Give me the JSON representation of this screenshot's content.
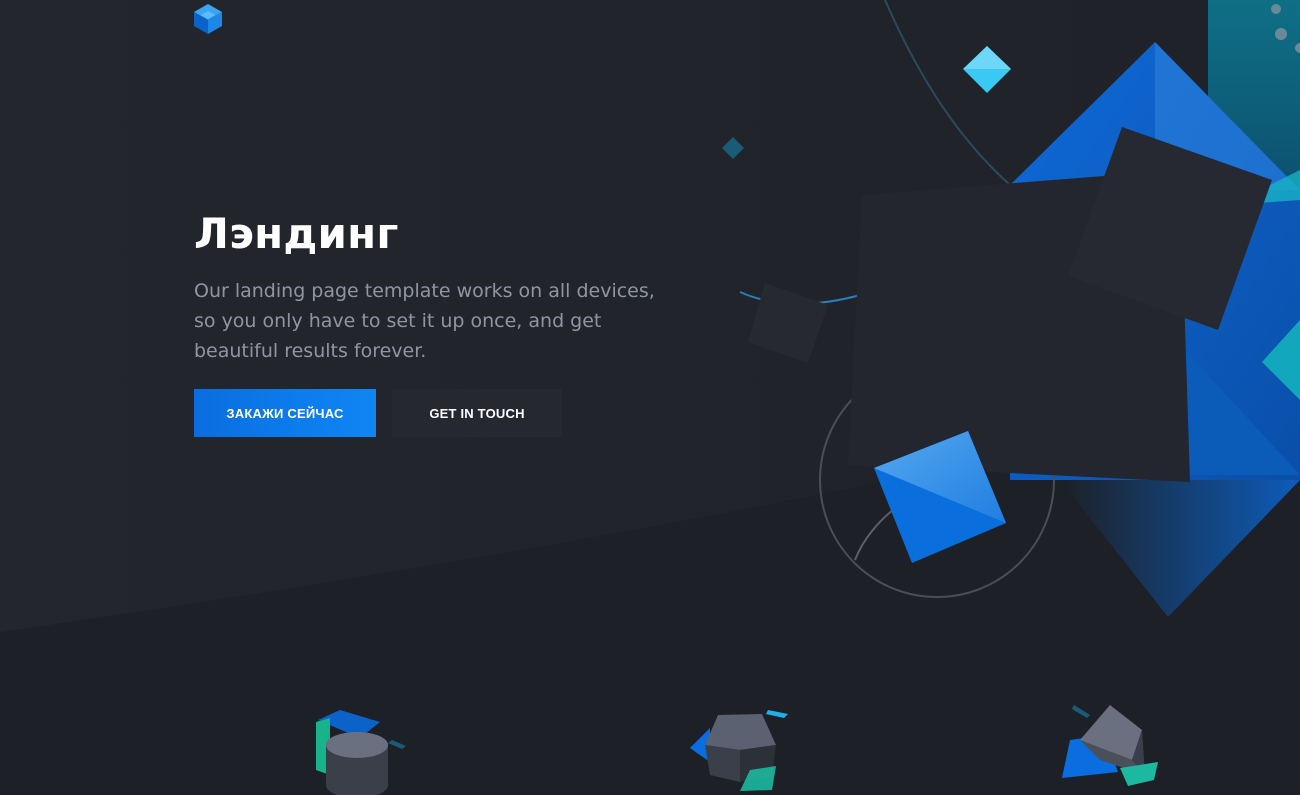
{
  "brand": {
    "logo_icon": "cube-logo-icon"
  },
  "hero": {
    "title": "Лэндинг",
    "text": "Our landing page template works on all devices, so you only have to set it up once, and get beautiful results forever.",
    "primary_button": "ЗАКАЖИ СЕЙЧАС",
    "secondary_button": "GET IN TOUCH"
  },
  "features": [
    {
      "icon": "cylinder-feature-icon"
    },
    {
      "icon": "cube-feature-icon"
    },
    {
      "icon": "pyramid-feature-icon"
    }
  ],
  "colors": {
    "background": "#1d2026",
    "accent": "#0a7cf0",
    "secondary_button": "#252830",
    "text_muted": "#8f95a3"
  }
}
